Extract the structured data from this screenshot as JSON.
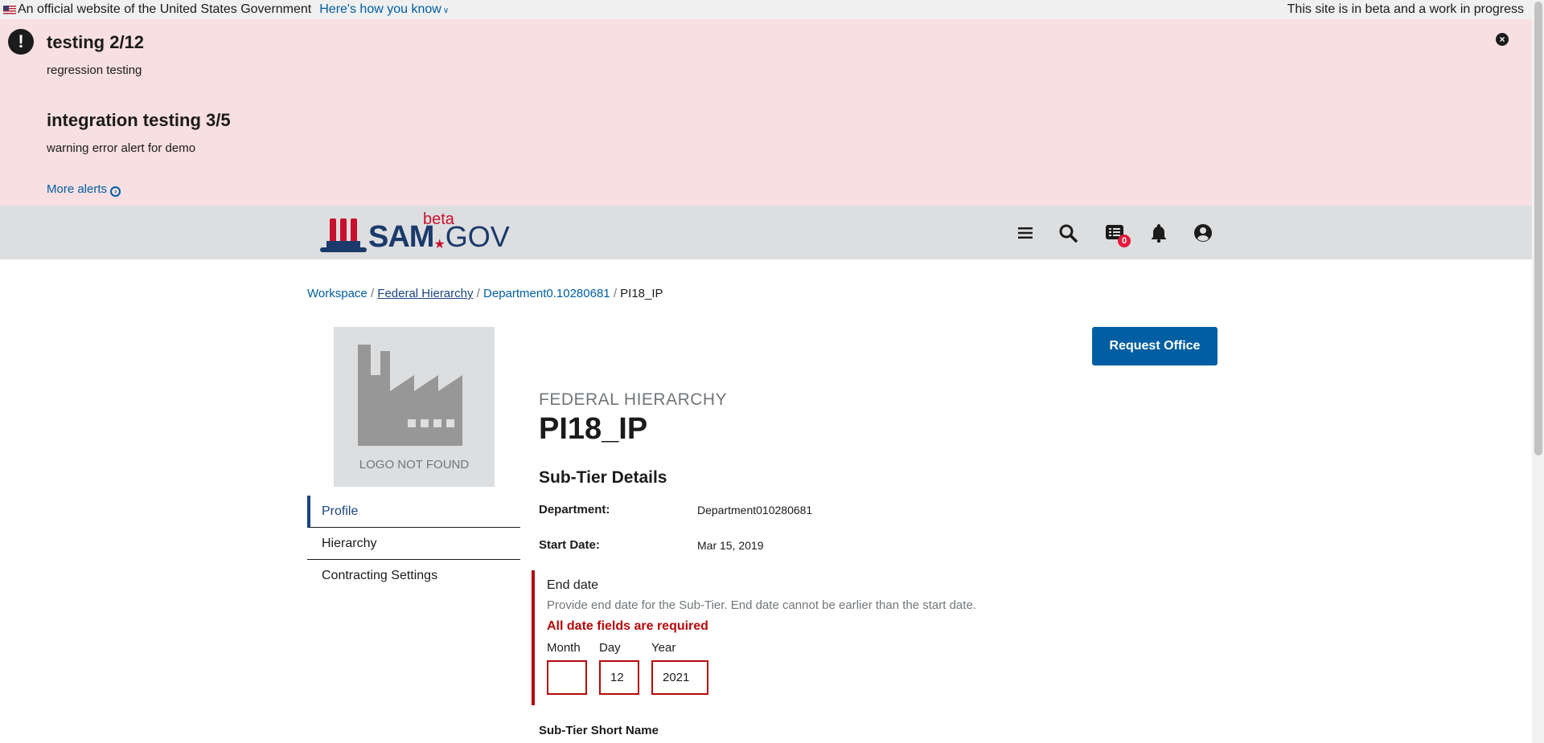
{
  "gov_banner": {
    "official_text": "An official website of the United States Government",
    "how_link": "Here's how you know",
    "beta_text": "This site is in beta and a work in progress"
  },
  "alerts": {
    "items": [
      {
        "title": "testing 2/12",
        "body": "regression testing"
      },
      {
        "title": "integration testing 3/5",
        "body": "warning error alert for demo"
      }
    ],
    "more_link": "More alerts"
  },
  "header": {
    "logo_sam": "SAM",
    "logo_gov": "GOV",
    "logo_beta": "beta",
    "messages_count": "0",
    "icons": [
      "menu-icon",
      "search-icon",
      "messages-icon",
      "bell-icon",
      "user-icon"
    ]
  },
  "breadcrumb": {
    "items": [
      "Workspace",
      "Federal Hierarchy",
      "Department0.10280681"
    ],
    "current": "PI18_IP",
    "separator": "/"
  },
  "logo_placeholder": "LOGO NOT FOUND",
  "sidenav": {
    "items": [
      "Profile",
      "Hierarchy",
      "Contracting Settings"
    ],
    "active": "Profile"
  },
  "main": {
    "request_button": "Request Office",
    "eyebrow": "FEDERAL HIERARCHY",
    "title": "PI18_IP",
    "section_title": "Sub-Tier Details",
    "department_label": "Department:",
    "department_value": "Department010280681",
    "start_date_label": "Start Date:",
    "start_date_value": "Mar 15, 2019",
    "end_date": {
      "label": "End date",
      "hint": "Provide end date for the Sub-Tier. End date cannot be earlier than the start date.",
      "error": "All date fields are required",
      "month_label": "Month",
      "day_label": "Day",
      "year_label": "Year",
      "month_value": "",
      "day_value": "12",
      "year_value": "2021"
    },
    "short_name_label": "Sub-Tier Short Name"
  },
  "colors": {
    "alert_bg": "#f8dfe1",
    "header_bg": "#dcdee0",
    "primary": "#005ea2",
    "error": "#b50909",
    "brand_navy": "#1a3a6b",
    "brand_red": "#c8102e"
  }
}
